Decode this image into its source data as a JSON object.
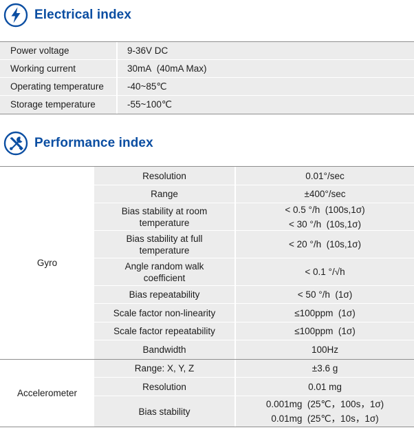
{
  "electrical": {
    "icon": "lightning-icon",
    "title": "Electrical index",
    "rows": [
      {
        "param": "Power voltage",
        "value": "9-36V DC"
      },
      {
        "param": "Working current",
        "value": "30mA  (40mA Max)"
      },
      {
        "param": "Operating temperature",
        "value": "-40~85℃"
      },
      {
        "param": "Storage temperature",
        "value": "-55~100℃"
      }
    ]
  },
  "performance": {
    "icon": "wrench-screwdriver-icon",
    "title": "Performance index",
    "gyro": {
      "name": "Gyro",
      "rows": [
        {
          "param": [
            "Resolution"
          ],
          "value": [
            "0.01°/sec"
          ]
        },
        {
          "param": [
            "Range"
          ],
          "value": [
            "±400°/sec"
          ]
        },
        {
          "param": [
            "Bias stability at room",
            "temperature"
          ],
          "value": [
            "< 0.5 °/h  (100s,1σ)",
            "< 30 °/h  (10s,1σ)"
          ]
        },
        {
          "param": [
            "Bias stability at full",
            "temperature"
          ],
          "value": [
            "< 20 °/h  (10s,1σ)"
          ]
        },
        {
          "param": [
            "Angle random walk",
            "coefficient"
          ],
          "value": [
            "< 0.1 °/√h"
          ]
        },
        {
          "param": [
            "Bias repeatability"
          ],
          "value": [
            "< 50 °/h  (1σ)"
          ]
        },
        {
          "param": [
            "Scale factor non-linearity"
          ],
          "value": [
            "≤100ppm  (1σ)"
          ]
        },
        {
          "param": [
            "Scale factor repeatability"
          ],
          "value": [
            "≤100ppm  (1σ)"
          ]
        },
        {
          "param": [
            "Bandwidth"
          ],
          "value": [
            "100Hz"
          ]
        }
      ]
    },
    "accel": {
      "name": "Accelerometer",
      "rows": [
        {
          "param": [
            "Range: X, Y, Z"
          ],
          "value": [
            "±3.6 g"
          ]
        },
        {
          "param": [
            "Resolution"
          ],
          "value": [
            "0.01 mg"
          ]
        },
        {
          "param": [
            "Bias stability"
          ],
          "value": [
            "0.001mg  (25℃，100s，1σ)",
            "0.01mg  (25℃，10s，1σ)"
          ]
        }
      ]
    }
  },
  "colors": {
    "accent": "#0b4ea2",
    "cell": "#ececec",
    "rule": "#8e8e8e"
  }
}
